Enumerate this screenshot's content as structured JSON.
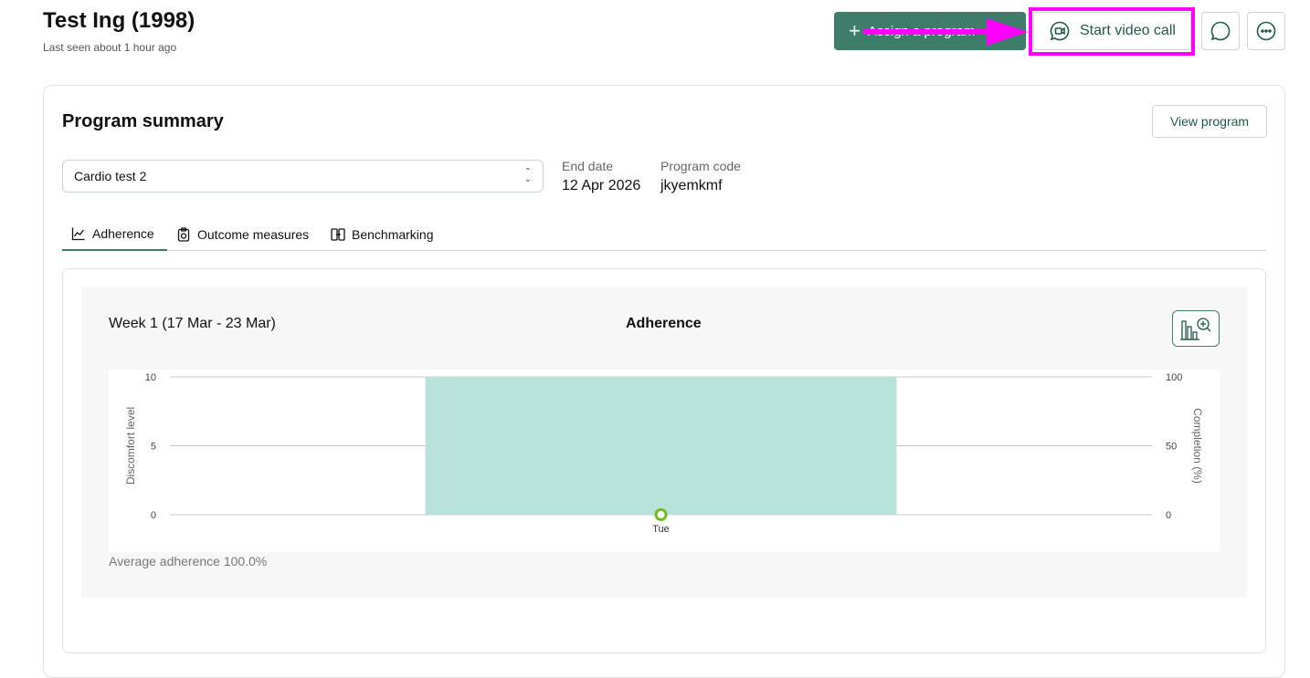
{
  "header": {
    "patient_name": "Test Ing (1998)",
    "last_seen": "Last seen about 1 hour ago",
    "assign_label": "Assign a program",
    "video_call_label": "Start video call",
    "message_icon": "chat-bubble-icon",
    "more_icon": "more-icon"
  },
  "card": {
    "title": "Program summary",
    "view_program_label": "View program",
    "program_select_value": "Cardio test 2",
    "end_date_label": "End date",
    "end_date_value": "12 Apr 2026",
    "program_code_label": "Program code",
    "program_code_value": "jkyemkmf",
    "tabs": [
      {
        "label": "Adherence",
        "icon": "line-chart-icon",
        "active": true
      },
      {
        "label": "Outcome measures",
        "icon": "clipboard-icon",
        "active": false
      },
      {
        "label": "Benchmarking",
        "icon": "compare-icon",
        "active": false
      }
    ]
  },
  "chart_panel": {
    "week_label": "Week 1 (17 Mar - 23 Mar)",
    "average_label": "Average adherence 100.0%"
  },
  "colors": {
    "accent": "#3d7d6a",
    "bar": "#b9e3da",
    "point": "#6cbd1f",
    "highlight": "#ff00ff"
  },
  "chart_data": {
    "type": "bar",
    "title": "Adherence",
    "categories": [
      "Tue"
    ],
    "series": [
      {
        "name": "Completion (%)",
        "axis": "right",
        "type": "bar",
        "values": [
          100
        ]
      },
      {
        "name": "Discomfort level",
        "axis": "left",
        "type": "scatter",
        "values": [
          0
        ]
      }
    ],
    "ylabel": "Discomfort level",
    "ylabel_right": "Completion (%)",
    "ylim": [
      0,
      10
    ],
    "ylim_right": [
      0,
      100
    ],
    "yticks": [
      0,
      5,
      10
    ],
    "yticks_right": [
      0,
      50,
      100
    ],
    "grid": true
  }
}
